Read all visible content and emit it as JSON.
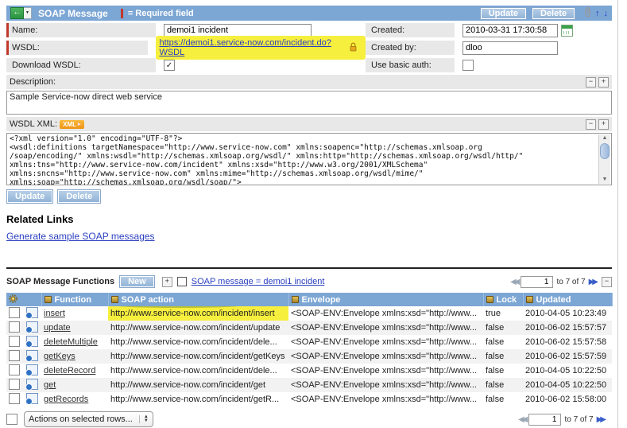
{
  "header": {
    "title": "SOAP Message",
    "required_label": "= Required field",
    "update_label": "Update",
    "delete_label": "Delete"
  },
  "form": {
    "name": {
      "label": "Name:",
      "value": "demoi1 incident"
    },
    "wsdl": {
      "label": "WSDL:",
      "value": "https://demoi1.service-now.com/incident.do?WSDL"
    },
    "download_wsdl": {
      "label": "Download WSDL:",
      "checked": true
    },
    "created": {
      "label": "Created:",
      "value": "2010-03-31 17:30:58"
    },
    "created_by": {
      "label": "Created by:",
      "value": "dloo"
    },
    "use_basic_auth": {
      "label": "Use basic auth:",
      "checked": false
    },
    "description": {
      "label": "Description:",
      "value": "Sample Service-now direct web service"
    },
    "wsdl_xml_label": "WSDL XML:",
    "wsdl_xml_content": "<?xml version=\"1.0\" encoding=\"UTF-8\"?>\n<wsdl:definitions targetNamespace=\"http://www.service-now.com\" xmlns:soapenc=\"http://schemas.xmlsoap.org\n/soap/encoding/\" xmlns:wsdl=\"http://schemas.xmlsoap.org/wsdl/\" xmlns:http=\"http://schemas.xmlsoap.org/wsdl/http/\"\nxmlns:tns=\"http://www.service-now.com/incident\" xmlns:xsd=\"http://www.w3.org/2001/XMLSchema\"\nxmlns:sncns=\"http://www.service-now.com\" xmlns:mime=\"http://schemas.xmlsoap.org/wsdl/mime/\"\nxmlns:soap=\"http://schemas.xmlsoap.org/wsdl/soap/\">"
  },
  "buttons": {
    "update": "Update",
    "delete": "Delete"
  },
  "related_links": {
    "heading": "Related Links",
    "generate_link": "Generate sample SOAP messages"
  },
  "functions_list": {
    "title": "SOAP Message Functions",
    "new_button": "New",
    "breadcrumb": "SOAP message = demoi1 incident",
    "paging": {
      "page": "1",
      "range": "to 7 of 7"
    },
    "columns": {
      "function": "Function",
      "soap_action": "SOAP action",
      "envelope": "Envelope",
      "lock": "Lock",
      "updated": "Updated"
    },
    "rows": [
      {
        "function": "insert",
        "soap_action": "http://www.service-now.com/incident/insert",
        "envelope": "<SOAP-ENV:Envelope xmlns:xsd=\"http://www...",
        "lock": "true",
        "updated": "2010-04-05 10:23:49",
        "highlight": true
      },
      {
        "function": "update",
        "soap_action": "http://www.service-now.com/incident/update",
        "envelope": "<SOAP-ENV:Envelope xmlns:xsd=\"http://www...",
        "lock": "false",
        "updated": "2010-06-02 15:57:57"
      },
      {
        "function": "deleteMultiple",
        "soap_action": "http://www.service-now.com/incident/dele...",
        "envelope": "<SOAP-ENV:Envelope xmlns:xsd=\"http://www...",
        "lock": "false",
        "updated": "2010-06-02 15:57:58"
      },
      {
        "function": "getKeys",
        "soap_action": "http://www.service-now.com/incident/getKeys",
        "envelope": "<SOAP-ENV:Envelope xmlns:xsd=\"http://www...",
        "lock": "false",
        "updated": "2010-06-02 15:57:59"
      },
      {
        "function": "deleteRecord",
        "soap_action": "http://www.service-now.com/incident/dele...",
        "envelope": "<SOAP-ENV:Envelope xmlns:xsd=\"http://www...",
        "lock": "false",
        "updated": "2010-04-05 10:22:50"
      },
      {
        "function": "get",
        "soap_action": "http://www.service-now.com/incident/get",
        "envelope": "<SOAP-ENV:Envelope xmlns:xsd=\"http://www...",
        "lock": "false",
        "updated": "2010-04-05 10:22:50"
      },
      {
        "function": "getRecords",
        "soap_action": "http://www.service-now.com/incident/getR...",
        "envelope": "<SOAP-ENV:Envelope xmlns:xsd=\"http://www...",
        "lock": "false",
        "updated": "2010-06-02 15:58:00"
      }
    ],
    "actions_select": "Actions on selected rows..."
  },
  "icons": {
    "back_arrow": "←",
    "dropdown_caret": "▼",
    "up_arrow": "↑",
    "down_arrow": "↓",
    "collapse_minus": "−",
    "expand_plus": "+",
    "check": "✓",
    "xml_badge": "XML",
    "xml_badge_arrow": "▸",
    "prev_arrows": "◀◀",
    "next_arrows": "▶▶",
    "scroll_up": "▲",
    "scroll_down": "▼",
    "select_up": "▲",
    "select_down": "▼"
  },
  "colors": {
    "header_bar": "#7ca6d4",
    "table_header": "#7ca6d4",
    "button_face": "#8fb2d6",
    "highlight_yellow": "#f7ef3e",
    "required_red": "#c0392b",
    "link_blue": "#2a3fc0",
    "label_gray": "#e8e8e8"
  }
}
